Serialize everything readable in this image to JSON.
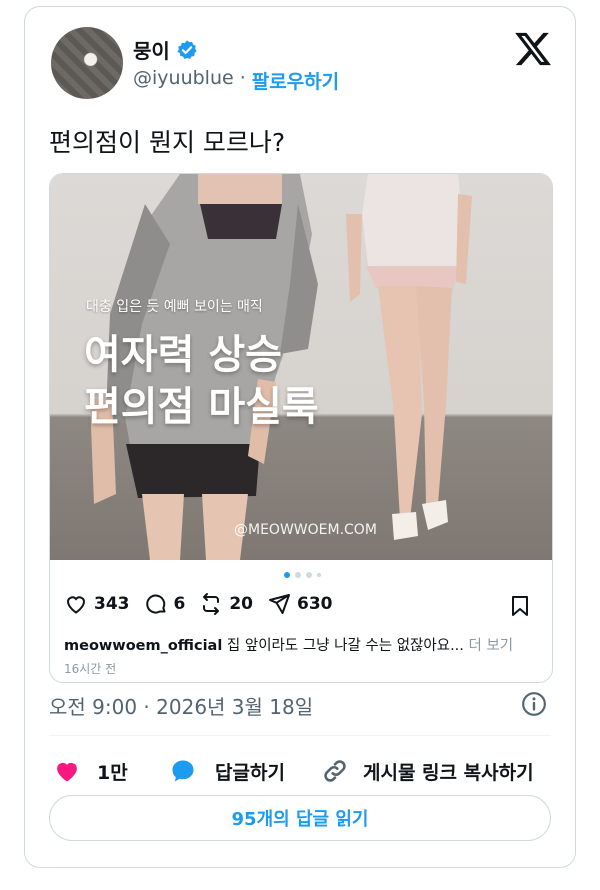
{
  "author": {
    "display_name": "뭉이",
    "handle": "@iyuublue",
    "separator": "·",
    "follow_label": "팔로우하기"
  },
  "tweet": {
    "text": "편의점이 뭔지 모르나?",
    "timestamp": "오전 9:00 · 2026년 3월 18일"
  },
  "embed": {
    "overlay_subtitle": "대충 입은 듯 예뻐 보이는 매직",
    "overlay_title_line1": "여자력 상승",
    "overlay_title_line2": "편의점 마실룩",
    "watermark": "@MEOWWOEM.COM",
    "likes": "343",
    "comments": "6",
    "reposts": "20",
    "shares": "630",
    "caption_user": "meowwoem_official",
    "caption_text": "집 앞이라도 그냥 나갈 수는 없잖아요...",
    "caption_more": "더 보기",
    "time_ago": "16시간 전"
  },
  "engagement": {
    "likes_count": "1만",
    "reply_label": "답글하기",
    "copy_link_label": "게시물 링크 복사하기",
    "read_replies_label": "95개의 답글 읽기"
  },
  "colors": {
    "accent": "#1d9bf0",
    "like": "#f91880",
    "text": "#0f1419",
    "muted": "#536471",
    "border": "#cfd9de"
  },
  "icons": [
    "verified-badge-icon",
    "x-logo-icon",
    "heart-icon",
    "comment-icon",
    "repost-icon",
    "send-icon",
    "bookmark-icon",
    "info-icon",
    "reply-bubble-icon",
    "link-icon"
  ]
}
